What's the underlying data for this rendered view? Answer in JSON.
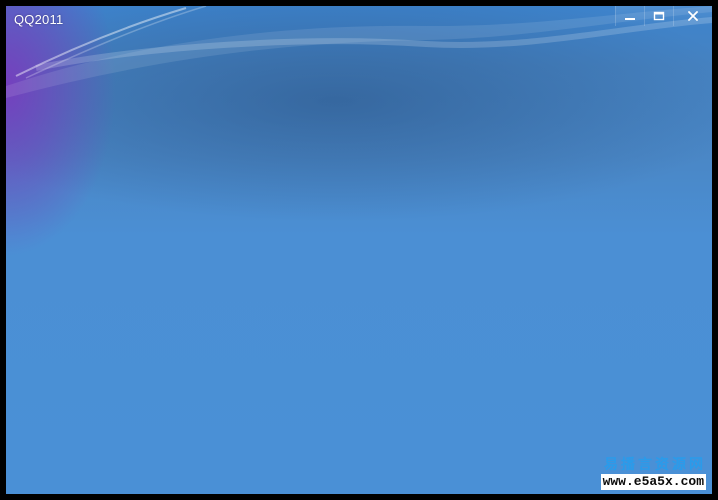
{
  "window": {
    "title": "QQ2011"
  },
  "controls": {
    "minimize_icon": "minimize-icon",
    "maximize_icon": "maximize-icon",
    "close_icon": "close-icon"
  },
  "colors": {
    "background_blue": "#4a90d6",
    "purple_glow": "#7a3cbe"
  },
  "watermark": {
    "site_name": "易播言资源网",
    "url": "www.e5a5x.com"
  }
}
